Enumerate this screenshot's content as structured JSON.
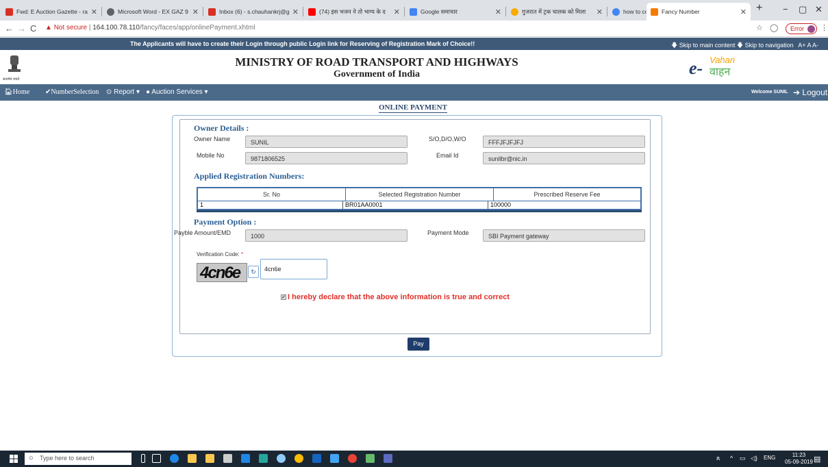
{
  "browser": {
    "tabs": [
      {
        "title": "Fwd: E Auction Gazette - ra",
        "color": "#d93025"
      },
      {
        "title": "Microsoft Word - EX GAZ 9",
        "color": "#5f6368"
      },
      {
        "title": "Inbox (6) - s.chauhankrj@g",
        "color": "#d93025"
      },
      {
        "title": "(74) इस भजन ने तो भाग्य के द",
        "color": "#ff0000"
      },
      {
        "title": "Google समाचार",
        "color": "#4285f4"
      },
      {
        "title": "गुजरात में ट्रक चालक को मिला",
        "color": "#f9ab00"
      },
      {
        "title": "how to compare timestamp",
        "color": "#4285f4"
      },
      {
        "title": "Fancy Number",
        "color": "#f57c00"
      }
    ],
    "new_tab": "+",
    "controls": {
      "minimize": "−",
      "maximize": "▢",
      "close": "✕"
    },
    "url_warning": "Not secure",
    "url_host": "164.100.78.110",
    "url_path": "/fancy/faces/app/onlinePayment.xhtml",
    "error_label": "Error"
  },
  "site": {
    "notice": "The Applicants will have to create their Login through public Login link for Reserving of Registration Mark of Choice!!",
    "skip_main": "Skip to main content",
    "skip_nav": "Skip to navigation",
    "font_sizes": "A+  A  A-",
    "emblem_caption": "सत्यमेव जयते",
    "ministry": "MINISTRY OF ROAD TRANSPORT AND HIGHWAYS",
    "government": "Government of India",
    "logo_e": "e-",
    "logo_vahan": "Vahan",
    "logo_hindi": "वाहन",
    "menu": {
      "home": "Home",
      "number_selection": "NumberSelection",
      "report": "Report",
      "auction_services": "Auction Services",
      "welcome": "Welcome SUNIL",
      "logout": "Logout"
    },
    "page_title": "ONLINE PAYMENT",
    "owner_details": {
      "heading": "Owner Details :",
      "owner_name_label": "Owner Name",
      "owner_name": "SUNIL",
      "sodowo_label": "S/O,D/O,W/O",
      "sodowo": "FFFJFJFJFJ",
      "mobile_label": "Mobile No",
      "mobile": "9871806525",
      "email_label": "Email Id",
      "email": "sunilbr@nic.in"
    },
    "applied": {
      "heading": "Applied Registration Numbers:",
      "columns": [
        "Sr. No",
        "Selected Registration Number",
        "Prescribed Reserve Fee"
      ],
      "rows": [
        [
          "1",
          "BR01AA0001",
          "100000"
        ]
      ]
    },
    "payment": {
      "heading": "Payment Option :",
      "amount_label": "Payble Amount/EMD",
      "amount": "1000",
      "mode_label": "Payment Mode",
      "mode": "SBI Payment gateway",
      "verification_label": "Verification Code:",
      "required_mark": "*",
      "captcha_text": "4cn6e",
      "verification_value": "4cn6e",
      "declaration": "I hereby declare that the above information is true and correct",
      "pay_button": "Pay"
    }
  },
  "taskbar": {
    "search_placeholder": "Type here to search",
    "lang": "ENG",
    "time": "11:23",
    "date": "05-09-2019"
  }
}
